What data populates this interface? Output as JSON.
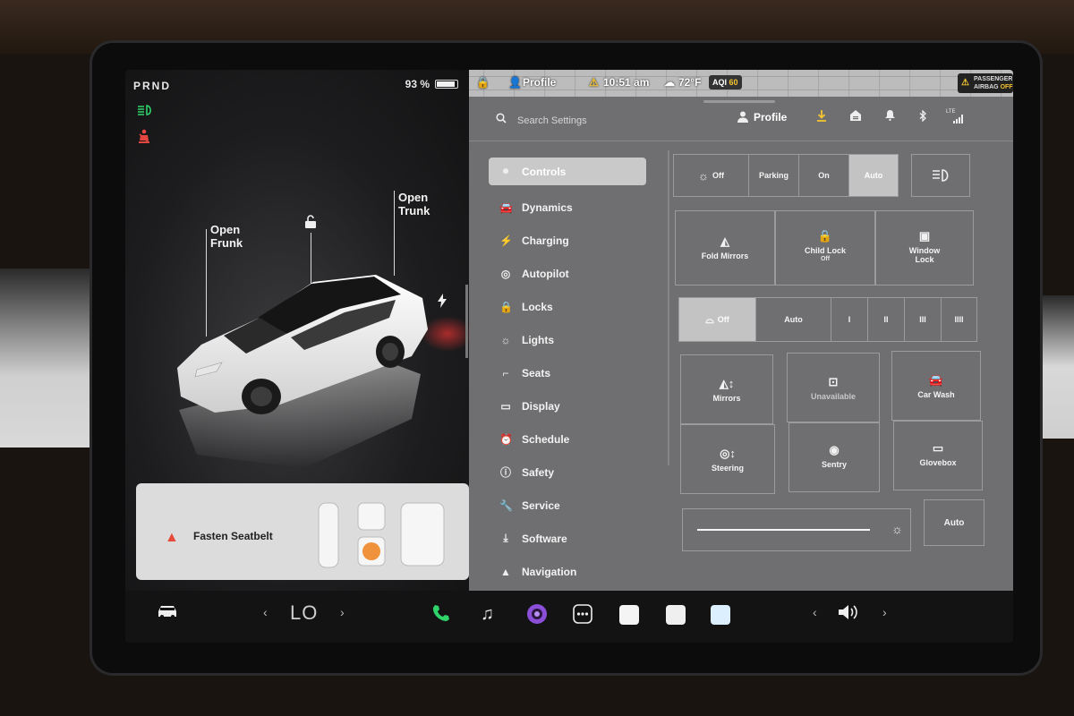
{
  "car_panel": {
    "gear": "PRND",
    "battery_percent": "93 %",
    "battery_level": 0.93,
    "open_frunk": [
      "Open",
      "Frunk"
    ],
    "open_trunk": [
      "Open",
      "Trunk"
    ],
    "seatbelt_alert": "Fasten Seatbelt",
    "colors": {
      "headlight_icon": "#2fd36a",
      "seatbelt_icon": "#e5463f"
    }
  },
  "status_bar": {
    "profile": "Profile",
    "time": "10:51 am",
    "temperature": "72°F",
    "aqi_label": "AQI",
    "aqi_value": "60",
    "airbag_line1": "PASSENGER",
    "airbag_line2": "AIRBAG",
    "airbag_state": "OFF"
  },
  "toolbar": {
    "search_placeholder": "Search Settings",
    "profile": "Profile",
    "lte": "LTE"
  },
  "nav": {
    "items": [
      {
        "label": "Controls",
        "icon": "toggle-icon"
      },
      {
        "label": "Dynamics",
        "icon": "car-icon"
      },
      {
        "label": "Charging",
        "icon": "bolt-icon"
      },
      {
        "label": "Autopilot",
        "icon": "steering-wheel-icon"
      },
      {
        "label": "Locks",
        "icon": "lock-icon"
      },
      {
        "label": "Lights",
        "icon": "sun-icon"
      },
      {
        "label": "Seats",
        "icon": "seat-icon"
      },
      {
        "label": "Display",
        "icon": "display-icon"
      },
      {
        "label": "Schedule",
        "icon": "alarm-icon"
      },
      {
        "label": "Safety",
        "icon": "safety-icon"
      },
      {
        "label": "Service",
        "icon": "wrench-icon"
      },
      {
        "label": "Software",
        "icon": "download-icon"
      },
      {
        "label": "Navigation",
        "icon": "navigation-icon"
      }
    ]
  },
  "controls": {
    "headlights": {
      "options": [
        "Off",
        "Parking",
        "On",
        "Auto"
      ],
      "selected": "Auto"
    },
    "fold_mirrors": "Fold Mirrors",
    "child_lock": "Child Lock",
    "child_lock_state": "Off",
    "window_lock": [
      "Window",
      "Lock"
    ],
    "wipers": {
      "options": [
        "Off",
        "Auto",
        "I",
        "II",
        "III",
        "IIII"
      ],
      "selected": "Off"
    },
    "mirrors": "Mirrors",
    "unavailable": "Unavailable",
    "car_wash": "Car Wash",
    "steering": "Steering",
    "sentry": "Sentry",
    "glovebox": "Glovebox",
    "brightness_level": 0.92,
    "brightness_auto": "Auto"
  },
  "bottom_bar": {
    "temp_left": "LO",
    "colors": {
      "phone": "#2fd36a",
      "camera": "#8a4fd6",
      "tile1": "#f4f4f4",
      "tile2": "#efefef",
      "tile3": "#dcefff"
    }
  }
}
